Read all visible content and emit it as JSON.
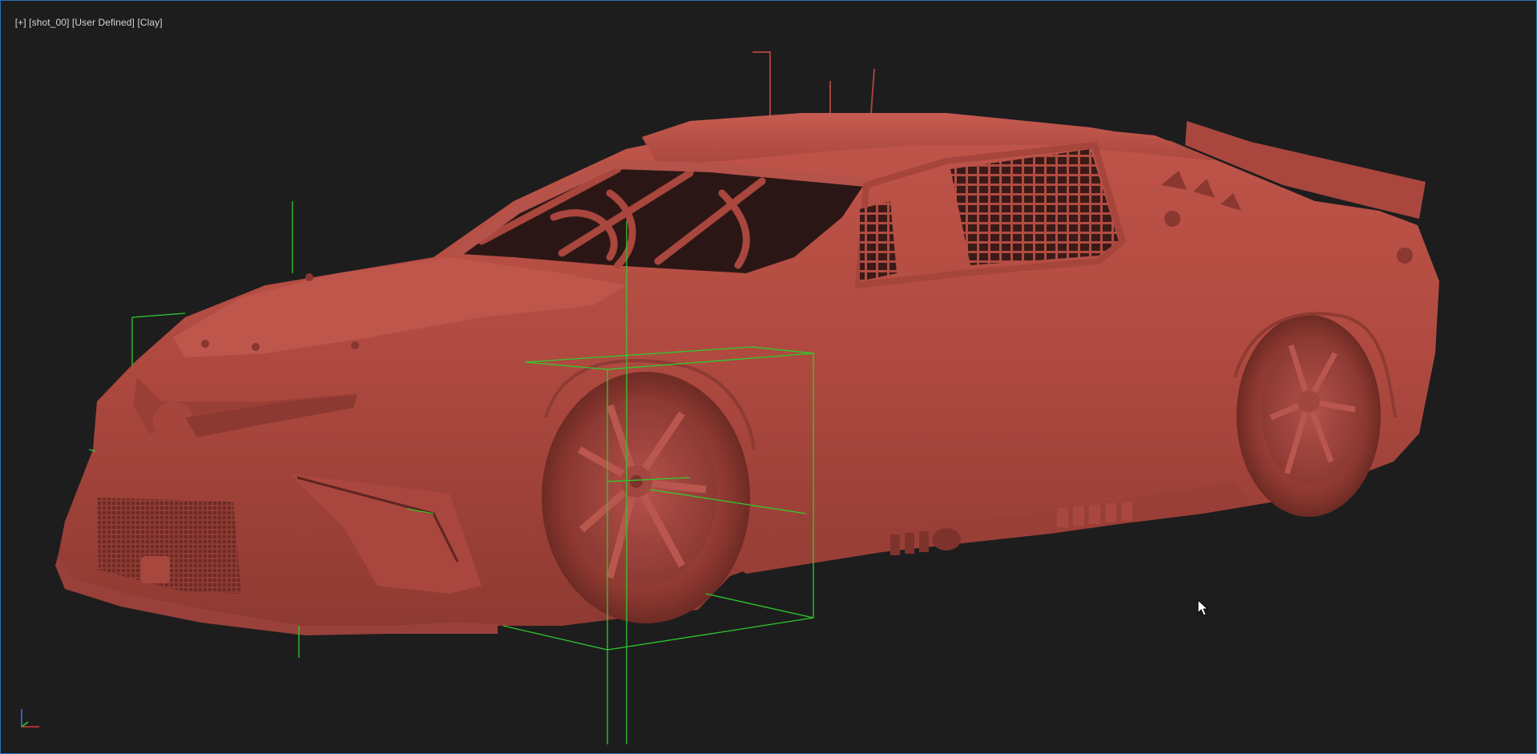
{
  "viewport": {
    "label_parts": [
      "[+]",
      "[shot_00]",
      "[User Defined]",
      "[Clay]"
    ],
    "shading_mode": "Clay",
    "camera": "shot_00",
    "view_type": "User Defined"
  },
  "scene": {
    "object": "race-car-model",
    "clay_color": "#b0493f",
    "selection_box_color": "#2ecc2e",
    "background_color": "#1d1d1d"
  },
  "icons": {
    "cursor": "mouse-pointer-icon",
    "axis": "view-axis-tripod-icon"
  }
}
